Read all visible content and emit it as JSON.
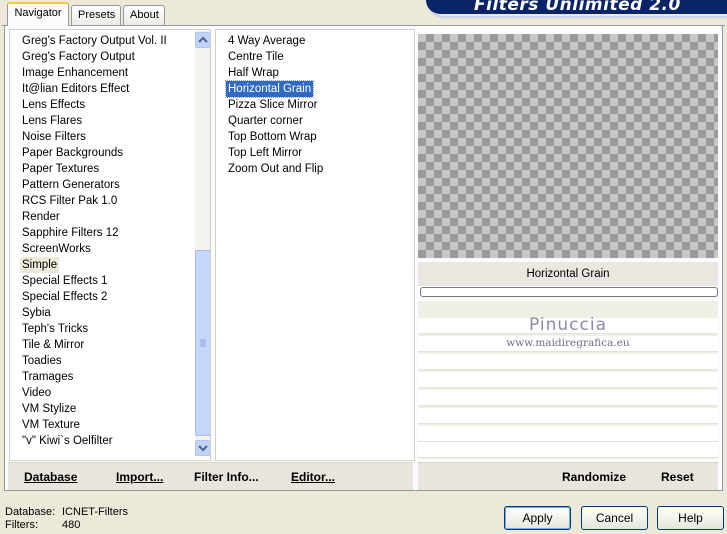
{
  "tabs": [
    {
      "label": "Navigator"
    },
    {
      "label": "Presets"
    },
    {
      "label": "About"
    }
  ],
  "banner_title": "Filters Unlimited 2.0",
  "categories": {
    "items": [
      "Greg's Factory Output Vol. II",
      "Greg's Factory Output",
      "Image Enhancement",
      "It@lian Editors Effect",
      "Lens Effects",
      "Lens Flares",
      "Noise Filters",
      "Paper Backgrounds",
      "Paper Textures",
      "Pattern Generators",
      "RCS Filter Pak 1.0",
      "Render",
      "Sapphire Filters 12",
      "ScreenWorks",
      "Simple",
      "Special Effects 1",
      "Special Effects 2",
      "Sybia",
      "Teph's Tricks",
      "Tile & Mirror",
      "Toadies",
      "Tramages",
      "Video",
      "VM Stylize",
      "VM Texture",
      "\"v\" Kiwi`s Oelfilter"
    ],
    "selected": "Simple"
  },
  "filters": {
    "items": [
      "4 Way Average",
      "Centre Tile",
      "Half Wrap",
      "Horizontal Grain",
      "Pizza Slice Mirror",
      "Quarter corner",
      "Top Bottom Wrap",
      "Top Left Mirror",
      "Zoom Out and Flip"
    ],
    "selected": "Horizontal Grain"
  },
  "preview": {
    "caption": "Horizontal Grain",
    "watermark_line1": "Pinuccia",
    "watermark_line2": "www.maidiregrafica.eu",
    "progress_percent": 0
  },
  "left_bar": {
    "database": "Database",
    "import": "Import...",
    "filter_info": "Filter Info...",
    "editor": "Editor..."
  },
  "right_bar": {
    "randomize": "Randomize",
    "reset": "Reset"
  },
  "status": {
    "database_label": "Database:",
    "database_value": "ICNET-Filters",
    "filters_label": "Filters:",
    "filters_value": "480"
  },
  "buttons": {
    "apply": "Apply",
    "cancel": "Cancel",
    "help": "Help"
  },
  "icons": [
    "scroll-up-arrow-icon",
    "scroll-down-arrow-icon",
    "scroll-thumb-grip-icon"
  ]
}
